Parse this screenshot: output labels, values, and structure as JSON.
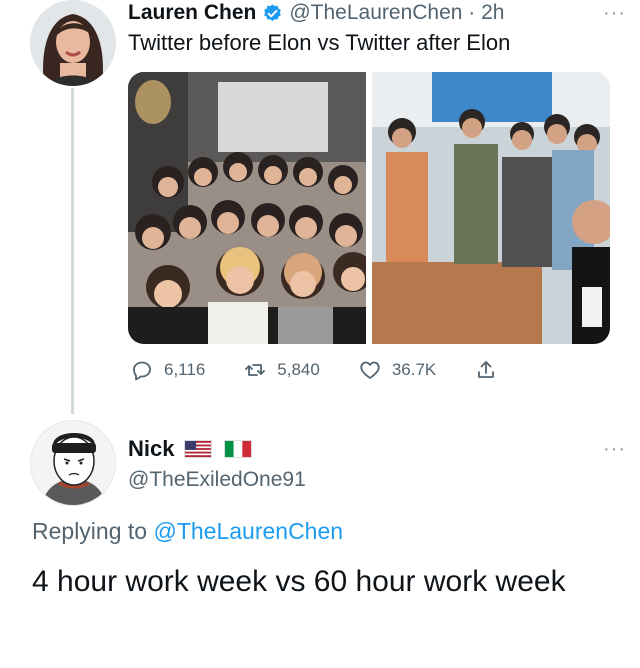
{
  "tweet": {
    "display_name": "Lauren Chen",
    "handle_time": "@TheLaurenChen · 2h",
    "more": "···",
    "text": "Twitter before Elon vs Twitter after Elon",
    "stats": {
      "replies": "6,116",
      "retweets": "5,840",
      "likes": "36.7K"
    },
    "verified_color": "#1d9bf0"
  },
  "reply": {
    "display_name": "Nick",
    "handle": "@TheExiledOne91",
    "more": "···",
    "replying_prefix": "Replying to ",
    "replying_mention": "@TheLaurenChen",
    "text": "4 hour work week vs 60 hour work week"
  },
  "colors": {
    "link": "#1d9bf0",
    "secondary_text": "#536471",
    "thread_line": "#cfd9de"
  },
  "icons": [
    "verified-badge-icon",
    "reply-icon",
    "retweet-icon",
    "like-icon",
    "share-icon",
    "us-flag-icon",
    "italy-flag-icon"
  ]
}
